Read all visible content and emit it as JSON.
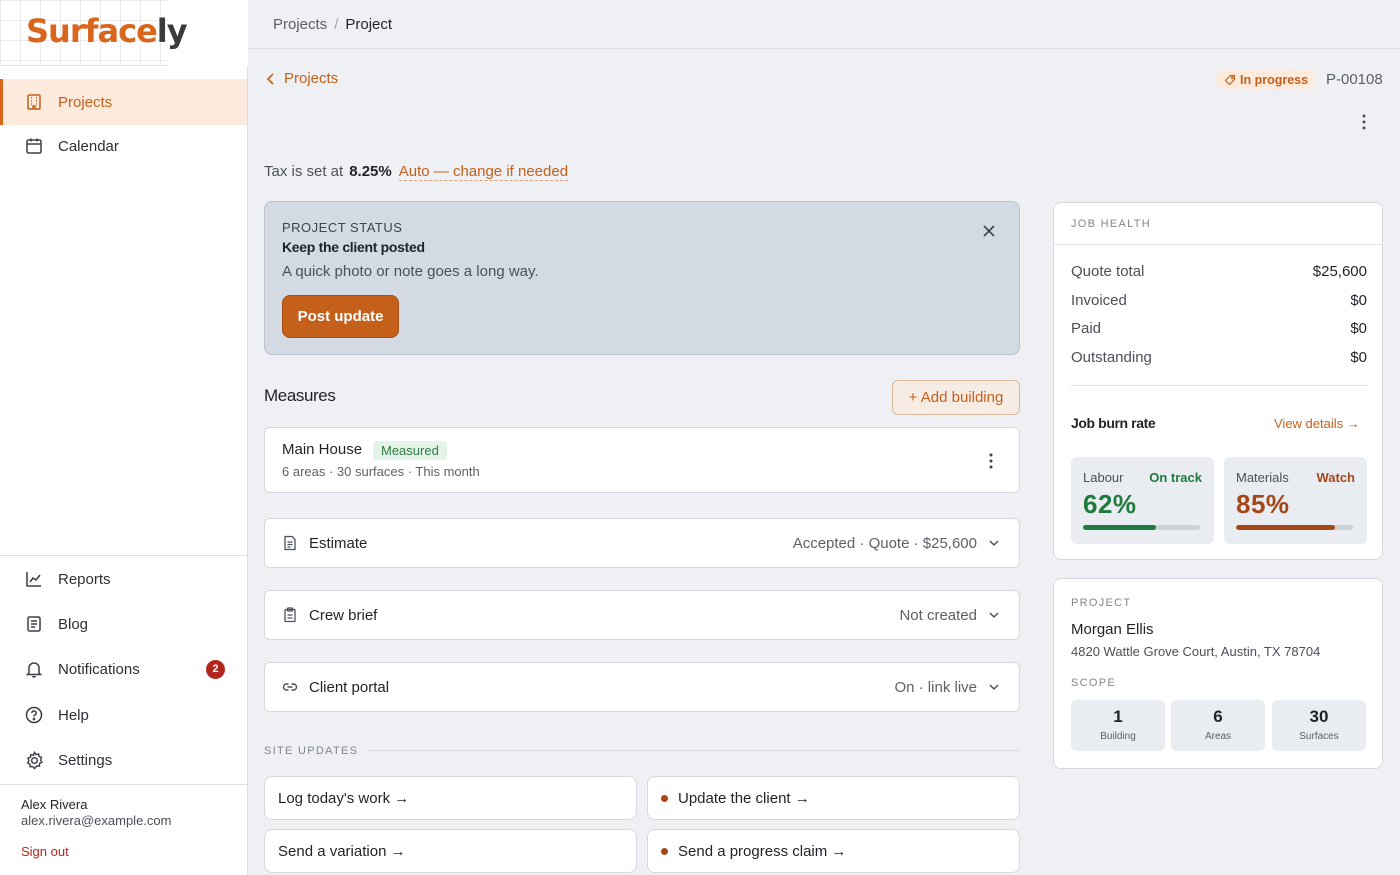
{
  "app": {
    "logo_main": "Surface",
    "logo_accent": "ly"
  },
  "sidebar": {
    "items": [
      {
        "label": "Projects",
        "icon": "building-icon"
      },
      {
        "label": "Calendar",
        "icon": "calendar-icon"
      }
    ],
    "bottom_items": [
      {
        "label": "Reports",
        "icon": "chart-icon"
      },
      {
        "label": "Blog",
        "icon": "document-icon"
      },
      {
        "label": "Notifications",
        "icon": "bell-icon",
        "badge": "2"
      },
      {
        "label": "Help",
        "icon": "help-icon"
      },
      {
        "label": "Settings",
        "icon": "gear-icon"
      }
    ],
    "user": {
      "name": "Alex Rivera",
      "email": "alex.rivera@example.com",
      "sign_out": "Sign out"
    }
  },
  "breadcrumb": {
    "parent": "Projects",
    "current": "Project"
  },
  "header": {
    "back_label": "Projects",
    "status": "In progress",
    "project_id": "P-00108"
  },
  "tax": {
    "prefix": "Tax is set at",
    "value": "8.25%",
    "link": "Auto — change if needed"
  },
  "status_card": {
    "label": "PROJECT STATUS",
    "title": "Keep the client posted",
    "subtitle": "A quick photo or note goes a long way.",
    "button": "Post update"
  },
  "measures": {
    "heading": "Measures",
    "add_button": "+ Add building",
    "building": {
      "name": "Main House",
      "tag": "Measured",
      "meta": "6 areas · 30 surfaces · This month"
    }
  },
  "sections": [
    {
      "title": "Estimate",
      "value": "Accepted · Quote · $25,600",
      "icon": "document-icon"
    },
    {
      "title": "Crew brief",
      "value": "Not created",
      "icon": "clipboard-icon"
    },
    {
      "title": "Client portal",
      "value": "On · link live",
      "icon": "link-icon"
    }
  ],
  "site_updates": {
    "label": "SITE UPDATES",
    "actions": [
      {
        "label": "Log today's work →",
        "dot": false
      },
      {
        "label": "Update the client →",
        "dot": true
      },
      {
        "label": "Send a variation →",
        "dot": false
      },
      {
        "label": "Send a progress claim →",
        "dot": true
      }
    ]
  },
  "job_health": {
    "label": "JOB HEALTH",
    "rows": [
      {
        "key": "Quote total",
        "value": "$25,600"
      },
      {
        "key": "Invoiced",
        "value": "$0"
      },
      {
        "key": "Paid",
        "value": "$0"
      },
      {
        "key": "Outstanding",
        "value": "$0"
      }
    ],
    "burn_title": "Job burn rate",
    "burn_link": "View details →",
    "burn": [
      {
        "key": "Labour",
        "status": "On track",
        "value": "62%",
        "fraction": 0.62,
        "color": "#1f7a3e"
      },
      {
        "key": "Materials",
        "status": "Watch",
        "value": "85%",
        "fraction": 0.85,
        "color": "#a4481a"
      }
    ]
  },
  "project": {
    "label": "PROJECT",
    "client": "Morgan Ellis",
    "address": "4820 Wattle Grove Court, Austin, TX 78704",
    "scope_label": "SCOPE",
    "scope": [
      {
        "num": "1",
        "label": "Building"
      },
      {
        "num": "6",
        "label": "Areas"
      },
      {
        "num": "30",
        "label": "Surfaces"
      }
    ]
  },
  "colors": {
    "accent": "#c5601b",
    "success": "#1f7a3e",
    "warning": "#a4481a",
    "danger": "#b3261e"
  }
}
